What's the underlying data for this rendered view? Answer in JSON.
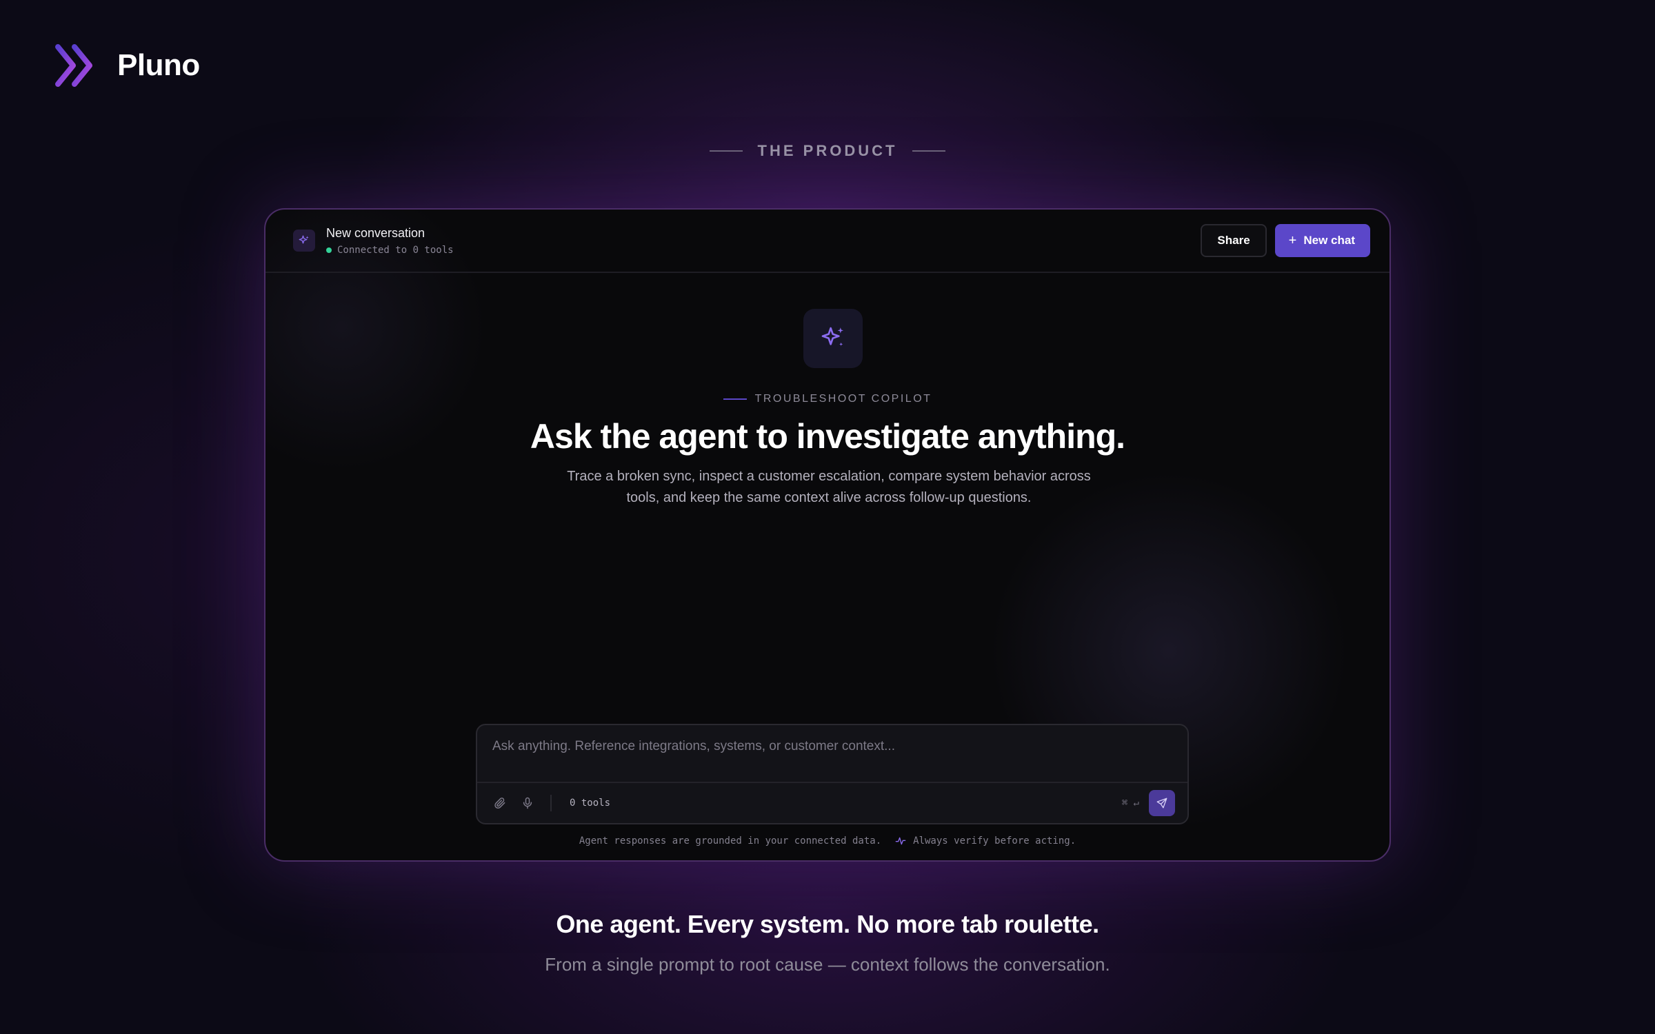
{
  "brand": {
    "name": "Pluno",
    "logo_icon": "double-chevron-right-icon",
    "accent": "#7c4ddb"
  },
  "section": {
    "eyebrow": "THE PRODUCT"
  },
  "window": {
    "header": {
      "title": "New conversation",
      "status": "Connected to 0 tools",
      "status_color": "#34d399",
      "share_label": "Share",
      "new_chat_label": "New chat",
      "new_chat_icon": "plus-icon"
    },
    "hero": {
      "icon": "sparkles-icon",
      "kicker": "TROUBLESHOOT COPILOT",
      "title": "Ask the agent to investigate anything.",
      "subtitle": "Trace a broken sync, inspect a customer escalation, compare system behavior across tools, and keep the same context alive across follow-up questions."
    },
    "composer": {
      "placeholder": "Ask anything. Reference integrations, systems, or customer context...",
      "value": "",
      "attach_icon": "paperclip-icon",
      "mic_icon": "microphone-icon",
      "tools_count": "0 tools",
      "shortcut": "⌘ ↵",
      "send_icon": "send-icon"
    },
    "footnote": {
      "left": "Agent responses are grounded in your connected data.",
      "right": "Always verify before acting.",
      "right_icon": "activity-icon"
    }
  },
  "bottom": {
    "tagline": "One agent. Every system. No more tab roulette.",
    "subtitle": "From a single prompt to root cause — context follows the conversation."
  },
  "colors": {
    "primary_button": "#5b47c9",
    "border_glow": "#4a2d66",
    "background": "#0c0a16"
  }
}
